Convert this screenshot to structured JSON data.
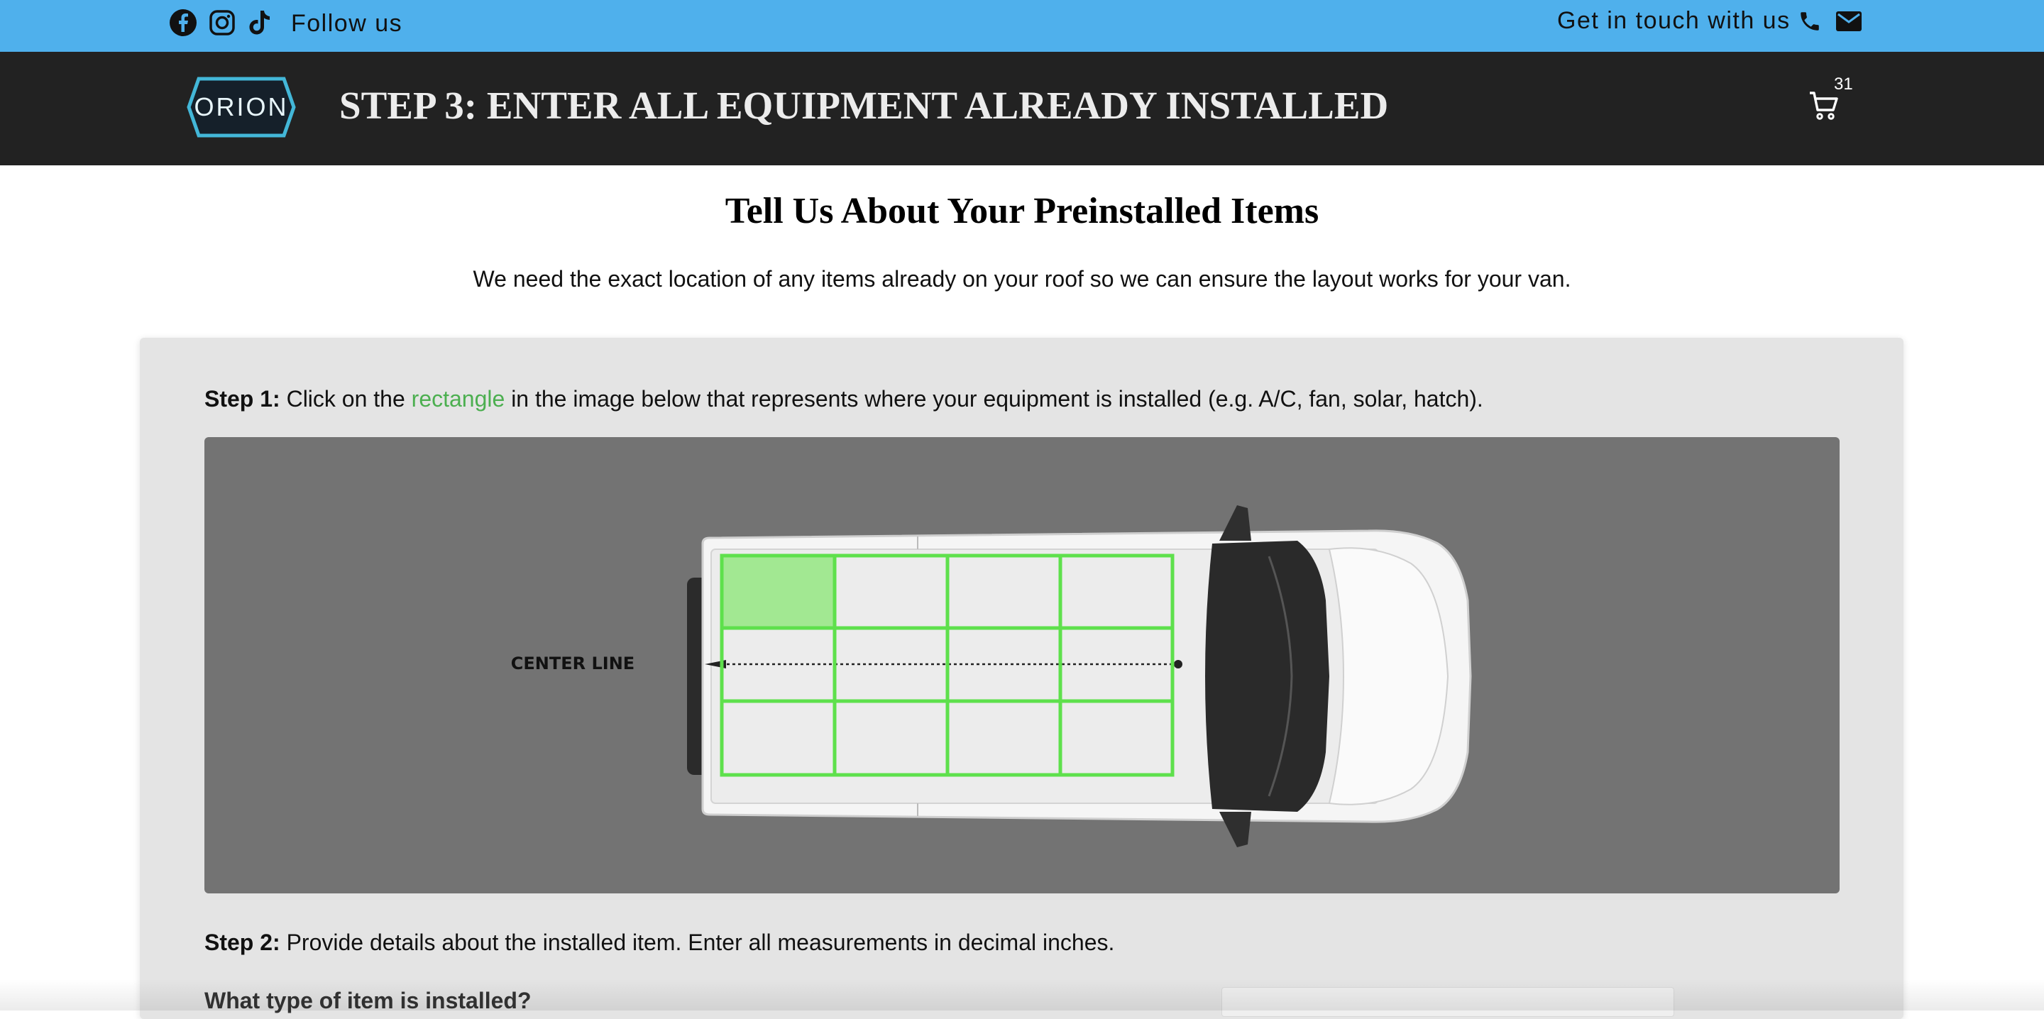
{
  "topbar": {
    "follow_label": "Follow us",
    "contact_label": "Get in touch with us",
    "social_icons": [
      "facebook-icon",
      "instagram-icon",
      "tiktok-icon"
    ],
    "contact_icons": [
      "phone-icon",
      "mail-icon"
    ],
    "background": "#4fb0ec"
  },
  "header": {
    "logo_text": "ORION",
    "title": "STEP 3: ENTER ALL EQUIPMENT ALREADY INSTALLED",
    "cart_count": "31",
    "background": "#222222"
  },
  "intro": {
    "title": "Tell Us About Your Preinstalled Items",
    "subtitle": "We need the exact location of any items already on your roof so we can ensure the layout works for your van."
  },
  "step1": {
    "label": "Step 1:",
    "text_before": "Click on the",
    "highlight": "rectangle",
    "text_after": "in the image below that represents where your equipment is installed (e.g. A/C, fan, solar, hatch)."
  },
  "diagram": {
    "center_line_label": "CENTER LINE",
    "grid": {
      "rows": 3,
      "cols": 4,
      "selected_cell": {
        "row": 1,
        "col": 1
      }
    },
    "grid_color": "#5ee04c",
    "selected_fill": "#a2e892"
  },
  "step2": {
    "label": "Step 2:",
    "text": "Provide details about the installed item. Enter all measurements in decimal inches."
  },
  "form": {
    "question": "What type of item is installed?",
    "select_value": ""
  }
}
